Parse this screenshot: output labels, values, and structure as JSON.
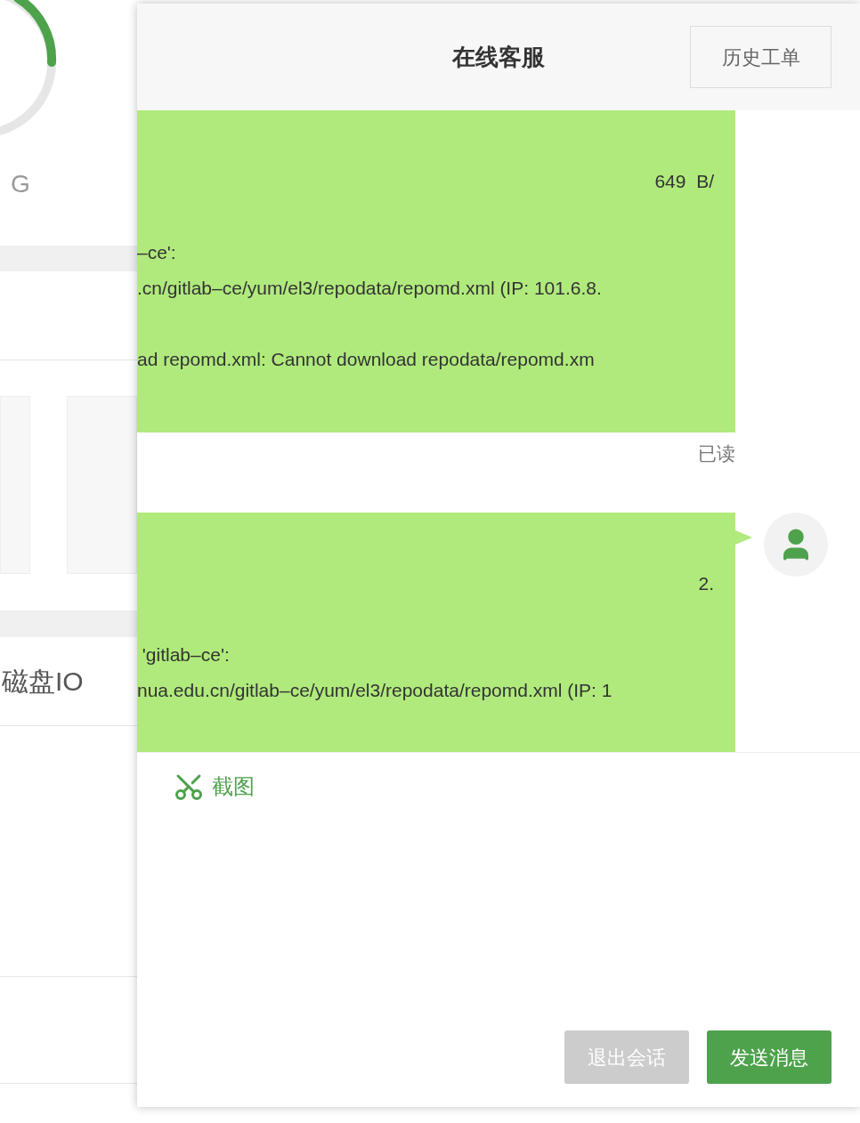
{
  "background": {
    "gauge_caption": "G",
    "section_title": "磁盘IO"
  },
  "chat": {
    "title": "在线客服",
    "history_button": "历史工单",
    "messages": [
      {
        "show_avatar": false,
        "read_status": "已读",
        "paragraphs": [
          {
            "kind": "right",
            "lines": [
              "649  B/"
            ]
          },
          {
            "kind": "left",
            "lines": [
              "–ce':",
              ".cn/gitlab–ce/yum/el3/repodata/repomd.xml (IP: 101.6.8."
            ]
          },
          {
            "kind": "left",
            "lines": [
              "ad repomd.xml: Cannot download repodata/repomd.xm"
            ]
          }
        ]
      },
      {
        "show_avatar": true,
        "paragraphs": [
          {
            "kind": "right",
            "lines": [
              "2."
            ]
          },
          {
            "kind": "left",
            "lines": [
              " 'gitlab–ce':",
              "nua.edu.cn/gitlab–ce/yum/el3/repodata/repomd.xml (IP: 1"
            ]
          }
        ]
      }
    ],
    "toolbar": {
      "screenshot_label": "截图"
    },
    "buttons": [
      {
        "label": "退出会话",
        "kind": "secondary"
      },
      {
        "label": "发送消息",
        "kind": "primary"
      }
    ]
  }
}
